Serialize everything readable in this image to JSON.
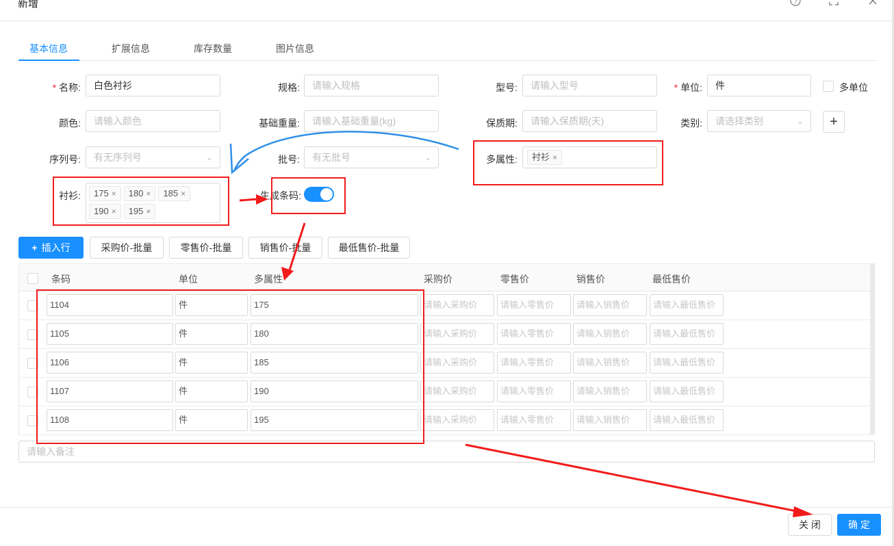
{
  "dialog": {
    "title": "新增",
    "icons": [
      "help-circle-icon",
      "fullscreen-icon",
      "close-icon"
    ]
  },
  "tabs": [
    {
      "label": "基本信息",
      "active": true
    },
    {
      "label": "扩展信息",
      "active": false
    },
    {
      "label": "库存数量",
      "active": false
    },
    {
      "label": "图片信息",
      "active": false
    }
  ],
  "form": {
    "name": {
      "label": "名称:",
      "value": "白色衬衫",
      "required": true
    },
    "spec": {
      "label": "规格:",
      "placeholder": "请输入规格"
    },
    "model": {
      "label": "型号:",
      "placeholder": "请输入型号"
    },
    "unit": {
      "label": "单位:",
      "value": "件",
      "required": true
    },
    "multi_unit": {
      "label": "多单位",
      "checked": false
    },
    "color": {
      "label": "颜色:",
      "placeholder": "请输入颜色"
    },
    "base_weight": {
      "label": "基础重量:",
      "placeholder": "请输入基础重量(kg)"
    },
    "shelf_life": {
      "label": "保质期:",
      "placeholder": "请输入保质期(天)"
    },
    "category": {
      "label": "类别:",
      "placeholder": "请选择类别"
    },
    "serial": {
      "label": "序列号:",
      "placeholder": "有无序列号"
    },
    "batch": {
      "label": "批号:",
      "placeholder": "有无批号"
    },
    "multi_attr": {
      "label": "多属性:",
      "tags": [
        "衬衫"
      ]
    },
    "shirt": {
      "label": "衬衫:",
      "tags": [
        "175",
        "180",
        "185",
        "190",
        "195"
      ]
    },
    "gen_barcode": {
      "label": "生成条码:",
      "on": true
    }
  },
  "toolbar": {
    "insert_row": "插入行",
    "purchase_batch": "采购价-批量",
    "retail_batch": "零售价-批量",
    "sale_batch": "销售价-批量",
    "min_sale_batch": "最低售价-批量"
  },
  "table": {
    "headers": [
      "条码",
      "单位",
      "多属性",
      "采购价",
      "零售价",
      "销售价",
      "最低售价"
    ],
    "placeholders": [
      "请输入采购价",
      "请输入零售价",
      "请输入销售价",
      "请输入最低售价"
    ],
    "rows": [
      {
        "barcode": "1104",
        "unit": "件",
        "attr": "175"
      },
      {
        "barcode": "1105",
        "unit": "件",
        "attr": "180"
      },
      {
        "barcode": "1106",
        "unit": "件",
        "attr": "185"
      },
      {
        "barcode": "1107",
        "unit": "件",
        "attr": "190"
      },
      {
        "barcode": "1108",
        "unit": "件",
        "attr": "195"
      }
    ]
  },
  "remark": {
    "placeholder": "请输入备注"
  },
  "footer": {
    "close": "关 闭",
    "confirm": "确 定"
  },
  "colors": {
    "primary": "#1890ff",
    "annotation": "#f21b1b",
    "annotation_curve": "#2f8fe8"
  }
}
